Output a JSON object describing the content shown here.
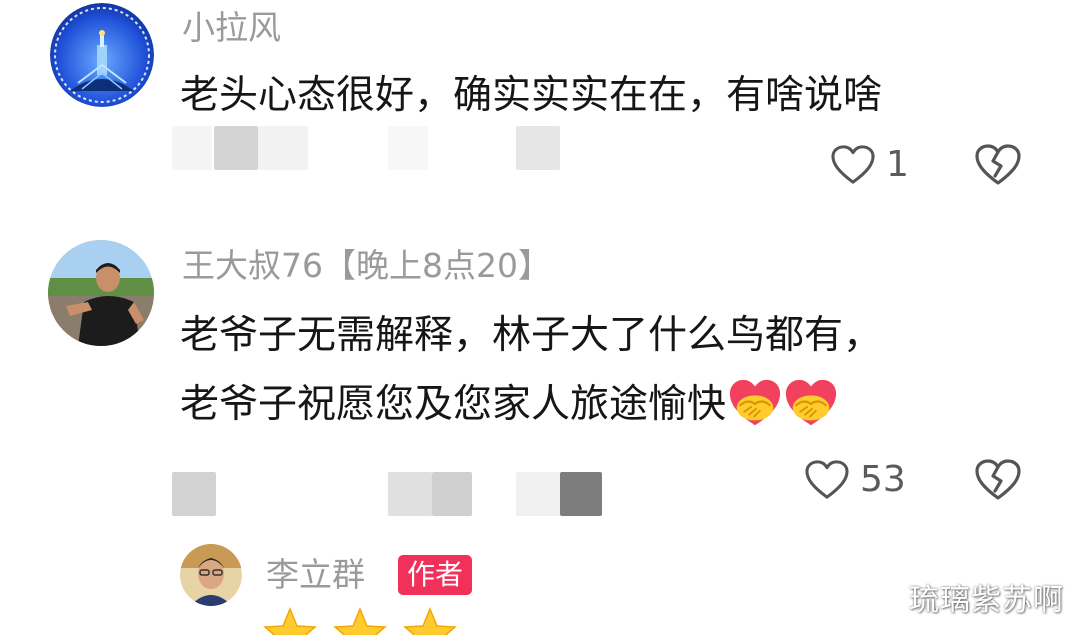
{
  "comments": [
    {
      "username": "小拉风",
      "text": "老头心态很好，确实实实在在，有啥说啥",
      "likes": "1"
    },
    {
      "username": "王大叔76【晚上8点20】",
      "text_line1": "老爷子无需解释，林子大了什么鸟都有，",
      "text_line2": "老爷子祝愿您及您家人旅途愉快",
      "emoji": "handshake-heart-emoji",
      "likes": "53"
    }
  ],
  "reply": {
    "username": "李立群",
    "badge": "作者"
  },
  "watermark": "琉璃紫苏啊",
  "colors": {
    "badge": "#f2315b",
    "username": "#9a9a9a",
    "text": "#161616",
    "icon": "#555555"
  }
}
